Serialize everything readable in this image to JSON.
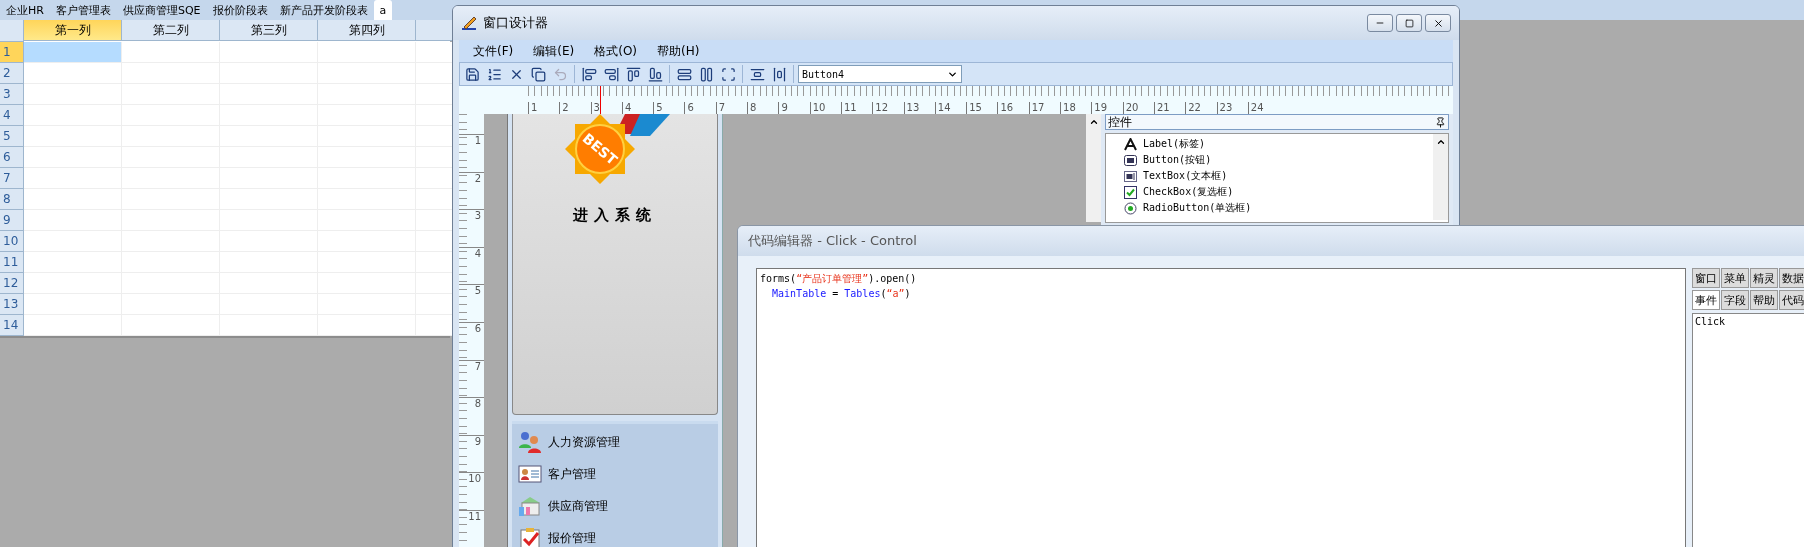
{
  "sheet_tabs": [
    {
      "label": "企业HR",
      "selected": false
    },
    {
      "label": "客户管理表",
      "selected": false
    },
    {
      "label": "供应商管理SQE",
      "selected": false
    },
    {
      "label": "报价阶段表",
      "selected": false
    },
    {
      "label": "新产品开发阶段表",
      "selected": false
    },
    {
      "label": "a",
      "selected": true
    }
  ],
  "grid": {
    "columns": [
      {
        "label": "第一列",
        "selected": true
      },
      {
        "label": "第二列",
        "selected": false
      },
      {
        "label": "第三列",
        "selected": false
      },
      {
        "label": "第四列",
        "selected": false
      }
    ],
    "rows": [
      {
        "label": "1",
        "selected": true
      },
      {
        "label": "2",
        "selected": false
      },
      {
        "label": "3",
        "selected": false
      },
      {
        "label": "4",
        "selected": false
      },
      {
        "label": "5",
        "selected": false
      },
      {
        "label": "6",
        "selected": false
      },
      {
        "label": "7",
        "selected": false
      },
      {
        "label": "8",
        "selected": false
      },
      {
        "label": "9",
        "selected": false
      },
      {
        "label": "10",
        "selected": false
      },
      {
        "label": "11",
        "selected": false
      },
      {
        "label": "12",
        "selected": false
      },
      {
        "label": "13",
        "selected": false
      },
      {
        "label": "14",
        "selected": false
      }
    ]
  },
  "designer": {
    "title": "窗口设计器",
    "menu": [
      "文件(F)",
      "编辑(E)",
      "格式(O)",
      "帮助(H)"
    ],
    "control_select": "Button4",
    "ruler_h": [
      "1",
      "2",
      "3",
      "4",
      "5",
      "6",
      "7",
      "8",
      "9",
      "10",
      "11",
      "12",
      "13",
      "14",
      "15",
      "16",
      "17",
      "18",
      "19",
      "20",
      "21",
      "22",
      "23",
      "24"
    ],
    "ruler_v": [
      "1",
      "2",
      "3",
      "4",
      "5",
      "6",
      "7",
      "8",
      "9",
      "10",
      "11"
    ],
    "form": {
      "badge": "BEST",
      "caption": "进入系统",
      "nav_items": [
        {
          "label": "人力资源管理",
          "kind": "people"
        },
        {
          "label": "客户管理",
          "kind": "card"
        },
        {
          "label": "供应商管理",
          "kind": "store"
        },
        {
          "label": "报价管理",
          "kind": "checklist"
        }
      ]
    },
    "toolbox": {
      "title": "控件",
      "items": [
        {
          "label": "Label(标签)",
          "kind": "label"
        },
        {
          "label": "Button(按钮)",
          "kind": "button"
        },
        {
          "label": "TextBox(文本框)",
          "kind": "textbox"
        },
        {
          "label": "CheckBox(复选框)",
          "kind": "checkbox"
        },
        {
          "label": "RadioButton(单选框)",
          "kind": "radio"
        }
      ]
    }
  },
  "code_editor": {
    "title": "代码编辑器 - Click - Control",
    "lines": [
      [
        {
          "kind": "plain",
          "text": "forms("
        },
        {
          "kind": "string",
          "text": "“产品订单管理”"
        },
        {
          "kind": "plain",
          "text": ").open()"
        }
      ],
      [
        {
          "kind": "ident",
          "text": "  MainTable"
        },
        {
          "kind": "plain",
          "text": " = "
        },
        {
          "kind": "ident",
          "text": "Tables"
        },
        {
          "kind": "plain",
          "text": "("
        },
        {
          "kind": "string",
          "text": "“a”"
        },
        {
          "kind": "plain",
          "text": ")"
        }
      ]
    ],
    "side_tabs": [
      [
        {
          "label": "窗口",
          "selected": false
        },
        {
          "label": "菜单",
          "selected": false
        },
        {
          "label": "精灵",
          "selected": false
        },
        {
          "label": "数据",
          "selected": false
        }
      ],
      [
        {
          "label": "事件",
          "selected": true
        },
        {
          "label": "字段",
          "selected": false
        },
        {
          "label": "帮助",
          "selected": false
        },
        {
          "label": "代码",
          "selected": false
        }
      ]
    ],
    "events": [
      "Click"
    ]
  }
}
